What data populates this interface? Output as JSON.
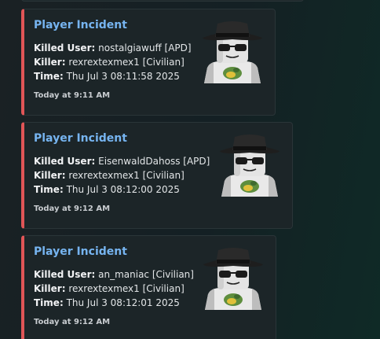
{
  "incidents": [
    {
      "title": "Player Incident",
      "killed_user_label": "Killed User:",
      "killed_user_value": "nostalgiawuff [APD]",
      "killer_label": "Killer:",
      "killer_value": "rexrextexmex1 [Civilian]",
      "time_label": "Time:",
      "time_value": "Thu Jul 3 08:11:58 2025",
      "footer": "Today at 9:11 AM"
    },
    {
      "title": "Player Incident",
      "killed_user_label": "Killed User:",
      "killed_user_value": "EisenwaldDahoss [APD]",
      "killer_label": "Killer:",
      "killer_value": "rexrextexmex1 [Civilian]",
      "time_label": "Time:",
      "time_value": "Thu Jul 3 08:12:00 2025",
      "footer": "Today at 9:12 AM"
    },
    {
      "title": "Player Incident",
      "killed_user_label": "Killed User:",
      "killed_user_value": "an_maniac [Civilian]",
      "killer_label": "Killer:",
      "killer_value": "rexrextexmex1 [Civilian]",
      "time_label": "Time:",
      "time_value": "Thu Jul 3 08:12:01 2025",
      "footer": "Today at 9:12 AM"
    }
  ],
  "colors": {
    "accent_bar": "#e05557",
    "title_link": "#76b4f0",
    "embed_bg": "#1c2528"
  },
  "thumbnail_icon": "roblox-avatar-fedora-sunglasses"
}
